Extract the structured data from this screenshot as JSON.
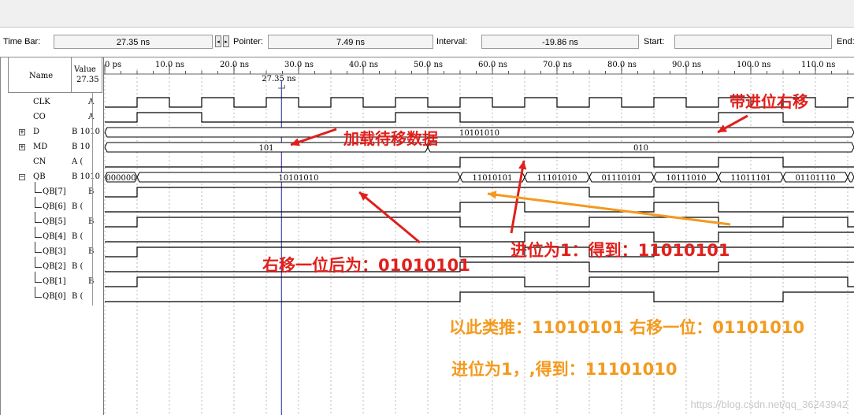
{
  "toolbar": {
    "time_bar_label": "Time Bar:",
    "time_bar_value": "27.35 ns",
    "pointer_label": "Pointer:",
    "pointer_value": "7.49 ns",
    "interval_label": "Interval:",
    "interval_value": "-19.86 ns",
    "start_label": "Start:",
    "start_value": "",
    "end_label": "End:",
    "spin_left": "◂",
    "spin_right": "▸"
  },
  "header": {
    "name": "Name",
    "value": "Value",
    "value_time": "27.35",
    "cursor_label": "27.35 ns"
  },
  "time_ticks": [
    "0 ps",
    "10.0 ns",
    "20.0 ns",
    "30.0 ns",
    "40.0 ns",
    "50.0 ns",
    "60.0 ns",
    "70.0 ns",
    "80.0 ns",
    "90.0 ns",
    "100.0 ns",
    "110.0 ns"
  ],
  "signals": [
    {
      "name": "CLK",
      "value": "A",
      "expand": ""
    },
    {
      "name": "CO",
      "value": "A",
      "expand": ""
    },
    {
      "name": "D",
      "value": "B 1010",
      "expand": "+"
    },
    {
      "name": "MD",
      "value": "B 10",
      "expand": "+"
    },
    {
      "name": "CN",
      "value": "A (",
      "expand": ""
    },
    {
      "name": "QB",
      "value": "B 1010",
      "expand": "−"
    },
    {
      "name": "QB[7]",
      "value": "B",
      "expand": ""
    },
    {
      "name": "QB[6]",
      "value": "B (",
      "expand": ""
    },
    {
      "name": "QB[5]",
      "value": "B",
      "expand": ""
    },
    {
      "name": "QB[4]",
      "value": "B (",
      "expand": ""
    },
    {
      "name": "QB[3]",
      "value": "B",
      "expand": ""
    },
    {
      "name": "QB[2]",
      "value": "B (",
      "expand": ""
    },
    {
      "name": "QB[1]",
      "value": "B",
      "expand": ""
    },
    {
      "name": "QB[0]",
      "value": "B (",
      "expand": ""
    }
  ],
  "bus_values": {
    "D": "10101010",
    "MD_a": "101",
    "MD_b": "010",
    "QB": [
      "000000",
      "10101010",
      "11010101",
      "11101010",
      "01110101",
      "10111010",
      "11011101",
      "01101110"
    ]
  },
  "annotations": {
    "load": "加载待移数据",
    "shift_carry": "带进位右移",
    "right_shift": "右移一位后为：01010101",
    "carry_one": "进位为1：得到：11010101",
    "analogy": "以此类推：11010101 右移一位：01101010",
    "carry_two": "进位为1，,得到：11101010"
  },
  "watermark": "https://blog.csdn.net/qq_36243942",
  "colors": {
    "annotation_red": "#e0201c",
    "annotation_orange": "#f39a1e",
    "cursor": "#2222aa"
  }
}
